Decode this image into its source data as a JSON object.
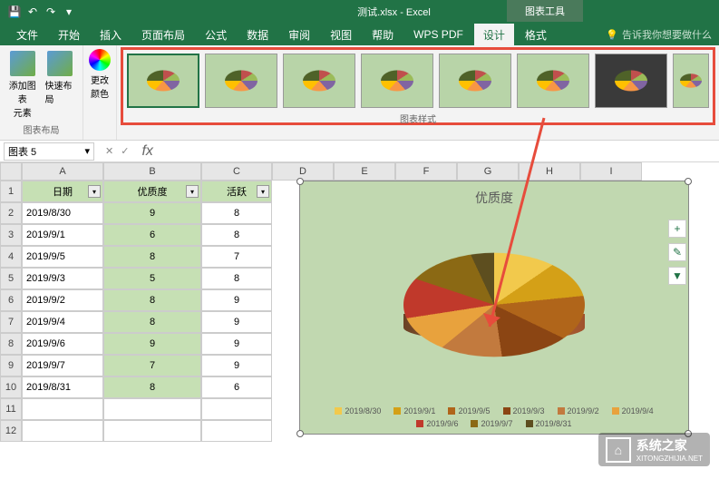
{
  "titlebar": {
    "filename": "测试.xlsx - Excel",
    "chart_tools": "图表工具"
  },
  "tabs": {
    "file": "文件",
    "home": "开始",
    "insert": "插入",
    "page_layout": "页面布局",
    "formulas": "公式",
    "data": "数据",
    "review": "审阅",
    "view": "视图",
    "help": "帮助",
    "wps_pdf": "WPS PDF",
    "design": "设计",
    "format": "格式",
    "tell_me": "告诉我你想要做什么"
  },
  "ribbon": {
    "add_element": "添加图表\n元素",
    "quick_layout": "快速布局",
    "change_colors": "更改\n颜色",
    "layout_group": "图表布局",
    "styles_group": "图表样式"
  },
  "namebox": {
    "value": "图表 5"
  },
  "columns": [
    "A",
    "B",
    "C",
    "D",
    "E",
    "F",
    "G",
    "H",
    "I"
  ],
  "rows": [
    "1",
    "2",
    "3",
    "4",
    "5",
    "6",
    "7",
    "8",
    "9",
    "10",
    "11",
    "12"
  ],
  "headers": {
    "date": "日期",
    "quality": "优质度",
    "activity": "活跃"
  },
  "table": [
    {
      "date": "2019/8/30",
      "quality": "9",
      "activity": "8"
    },
    {
      "date": "2019/9/1",
      "quality": "6",
      "activity": "8"
    },
    {
      "date": "2019/9/5",
      "quality": "8",
      "activity": "7"
    },
    {
      "date": "2019/9/3",
      "quality": "5",
      "activity": "8"
    },
    {
      "date": "2019/9/2",
      "quality": "8",
      "activity": "9"
    },
    {
      "date": "2019/9/4",
      "quality": "8",
      "activity": "9"
    },
    {
      "date": "2019/9/6",
      "quality": "9",
      "activity": "9"
    },
    {
      "date": "2019/9/7",
      "quality": "7",
      "activity": "9"
    },
    {
      "date": "2019/8/31",
      "quality": "8",
      "activity": "6"
    }
  ],
  "chart_data": {
    "type": "pie",
    "title": "优质度",
    "categories": [
      "2019/8/30",
      "2019/9/1",
      "2019/9/5",
      "2019/9/3",
      "2019/9/2",
      "2019/9/4",
      "2019/9/6",
      "2019/9/7",
      "2019/8/31"
    ],
    "values": [
      9,
      6,
      8,
      5,
      8,
      8,
      9,
      7,
      8
    ],
    "colors": [
      "#f2c94c",
      "#d4a017",
      "#b0651a",
      "#8b4513",
      "#c27a3e",
      "#e8a23d",
      "#c0392b",
      "#8b6914",
      "#5d4e1f"
    ]
  },
  "side_buttons": {
    "plus": "+",
    "brush": "✎",
    "filter": "▼"
  },
  "watermark": {
    "name": "系统之家",
    "url": "XITONGZHIJIA.NET"
  }
}
